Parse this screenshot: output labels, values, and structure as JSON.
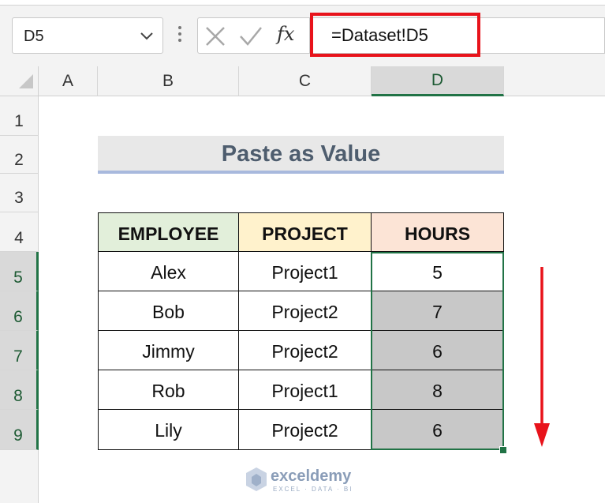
{
  "name_box": {
    "value": "D5"
  },
  "formula_bar": {
    "formula": "=Dataset!D5"
  },
  "columns": [
    "A",
    "B",
    "C",
    "D"
  ],
  "rows": [
    "1",
    "2",
    "3",
    "4",
    "5",
    "6",
    "7",
    "8",
    "9"
  ],
  "title": "Paste as Value",
  "table": {
    "headers": [
      "EMPLOYEE",
      "PROJECT",
      "HOURS"
    ],
    "header_colors": [
      "#e2efda",
      "#fff2cc",
      "#fce4d6"
    ],
    "rows": [
      [
        "Alex",
        "Project1",
        "5"
      ],
      [
        "Bob",
        "Project2",
        "7"
      ],
      [
        "Jimmy",
        "Project2",
        "6"
      ],
      [
        "Rob",
        "Project1",
        "8"
      ],
      [
        "Lily",
        "Project2",
        "6"
      ]
    ]
  },
  "selection": {
    "active_cell": "D5",
    "range": "D5:D9",
    "fill_color": "#c8c8c8"
  },
  "watermark": {
    "name": "exceldemy",
    "tagline": "EXCEL · DATA · BI"
  },
  "colors": {
    "accent_green": "#217346",
    "highlight_red": "#e8131b"
  }
}
